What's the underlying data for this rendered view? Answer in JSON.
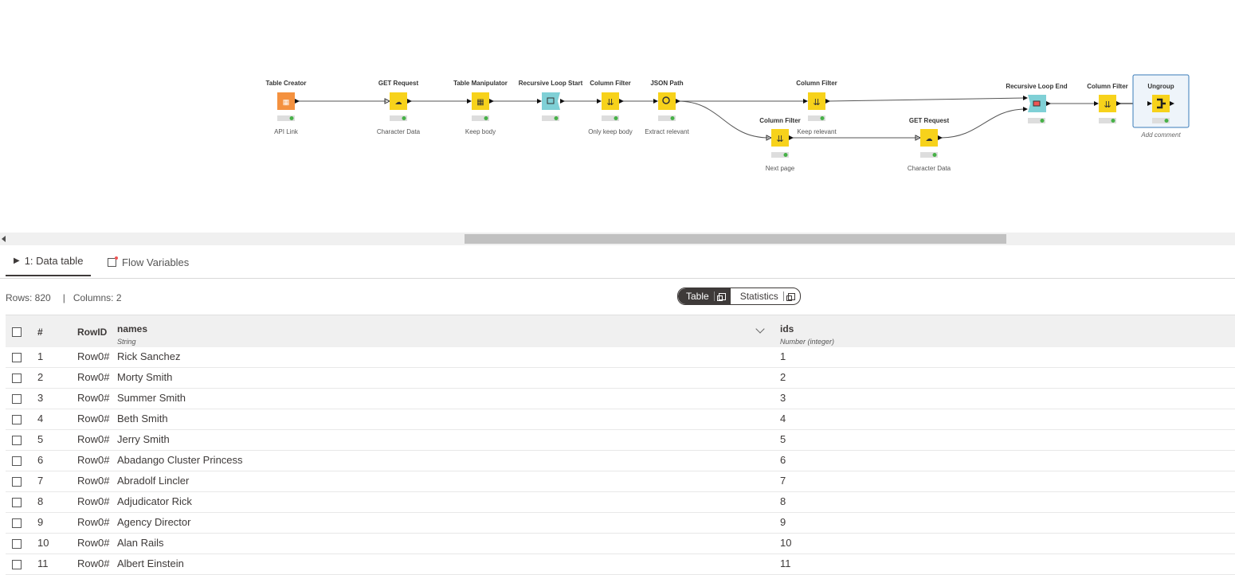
{
  "workflow": {
    "nodes": [
      {
        "title": "Table Creator",
        "label": "API Link",
        "type": "source",
        "color": "#f4913f"
      },
      {
        "title": "GET Request",
        "label": "Character Data",
        "type": "request",
        "color": "#f7d21b"
      },
      {
        "title": "Table Manipulator",
        "label": "Keep body",
        "type": "manipulator",
        "color": "#f7d21b"
      },
      {
        "title": "Recursive Loop Start",
        "label": "",
        "type": "loop-start",
        "color": "#7fd0d6"
      },
      {
        "title": "Column Filter",
        "label": "Only keep body",
        "type": "filter",
        "color": "#f7d21b"
      },
      {
        "title": "JSON Path",
        "label": "Extract relevant",
        "type": "json",
        "color": "#f7d21b"
      },
      {
        "title": "Column Filter",
        "label": "Keep relevant",
        "type": "filter",
        "color": "#f7d21b"
      },
      {
        "title": "Column Filter",
        "label": "Next page",
        "type": "filter",
        "color": "#f7d21b"
      },
      {
        "title": "GET Request",
        "label": "Character Data",
        "type": "request",
        "color": "#f7d21b"
      },
      {
        "title": "Recursive Loop End",
        "label": "",
        "type": "loop-end",
        "color": "#7fd0d6"
      },
      {
        "title": "Column Filter",
        "label": "",
        "type": "filter",
        "color": "#f7d21b"
      },
      {
        "title": "Ungroup",
        "label": "Add comment",
        "type": "ungroup",
        "color": "#f7d21b"
      }
    ]
  },
  "tabs": [
    {
      "label": "1: Data table",
      "icon": "play-icon",
      "active": true
    },
    {
      "label": "Flow Variables",
      "icon": "flow-variable-icon",
      "active": false
    }
  ],
  "info": {
    "rows": "Rows: 820",
    "sep": "|",
    "columns": "Columns: 2"
  },
  "view_toggle": {
    "table": "Table",
    "statistics": "Statistics"
  },
  "table": {
    "headers": {
      "num": "#",
      "rowid": "RowID",
      "names": {
        "title": "names",
        "type": "String"
      },
      "ids": {
        "title": "ids",
        "type": "Number (integer)"
      }
    },
    "rows": [
      {
        "num": "1",
        "rowid": "Row0#",
        "name": "Rick Sanchez",
        "id": "1"
      },
      {
        "num": "2",
        "rowid": "Row0#",
        "name": "Morty Smith",
        "id": "2"
      },
      {
        "num": "3",
        "rowid": "Row0#",
        "name": "Summer Smith",
        "id": "3"
      },
      {
        "num": "4",
        "rowid": "Row0#",
        "name": "Beth Smith",
        "id": "4"
      },
      {
        "num": "5",
        "rowid": "Row0#",
        "name": "Jerry Smith",
        "id": "5"
      },
      {
        "num": "6",
        "rowid": "Row0#",
        "name": "Abadango Cluster Princess",
        "id": "6"
      },
      {
        "num": "7",
        "rowid": "Row0#",
        "name": "Abradolf Lincler",
        "id": "7"
      },
      {
        "num": "8",
        "rowid": "Row0#",
        "name": "Adjudicator Rick",
        "id": "8"
      },
      {
        "num": "9",
        "rowid": "Row0#",
        "name": "Agency Director",
        "id": "9"
      },
      {
        "num": "10",
        "rowid": "Row0#",
        "name": "Alan Rails",
        "id": "10"
      },
      {
        "num": "11",
        "rowid": "Row0#",
        "name": "Albert Einstein",
        "id": "11"
      }
    ]
  }
}
